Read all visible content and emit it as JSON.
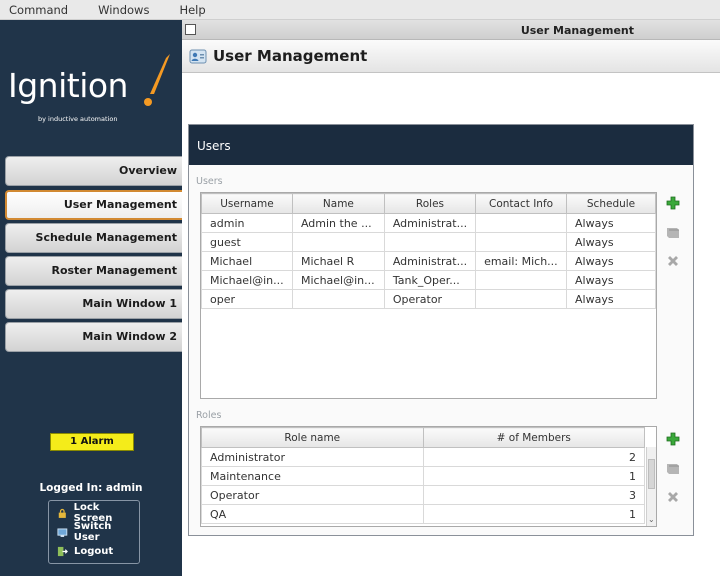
{
  "menu": [
    "Command",
    "Windows",
    "Help"
  ],
  "logo": {
    "word": "Ignition",
    "sub": "by inductive automation"
  },
  "nav": [
    {
      "label": "Overview"
    },
    {
      "label": "User Management"
    },
    {
      "label": "Schedule Management"
    },
    {
      "label": "Roster Management"
    },
    {
      "label": "Main Window 1"
    },
    {
      "label": "Main Window 2"
    }
  ],
  "alarm": {
    "label": "1 Alarm"
  },
  "logged_in": "Logged In: admin",
  "actions": [
    {
      "label": "Lock Screen",
      "icon": "lock-icon"
    },
    {
      "label": "Switch User",
      "icon": "monitor-icon"
    },
    {
      "label": "Logout",
      "icon": "logout-icon"
    }
  ],
  "window_title": "User Management",
  "header_title": "User Management",
  "panel": {
    "title": "Users",
    "users_label": "Users",
    "roles_label": "Roles"
  },
  "users_table": {
    "columns": [
      "Username",
      "Name",
      "Roles",
      "Contact Info",
      "Schedule"
    ],
    "rows": [
      [
        "admin",
        "Admin the ...",
        "Administrat...",
        "",
        "Always"
      ],
      [
        "guest",
        "",
        "",
        "",
        "Always"
      ],
      [
        "Michael",
        "Michael R",
        "Administrat...",
        "email: Mich...",
        "Always"
      ],
      [
        "Michael@in...",
        "Michael@in...",
        "Tank_Oper...",
        "",
        "Always"
      ],
      [
        "oper",
        "",
        "Operator",
        "",
        "Always"
      ]
    ]
  },
  "roles_table": {
    "columns": [
      "Role name",
      "# of Members"
    ],
    "rows": [
      [
        "Administrator",
        "2"
      ],
      [
        "Maintenance",
        "1"
      ],
      [
        "Operator",
        "3"
      ],
      [
        "QA",
        "1"
      ]
    ]
  },
  "colors": {
    "sidebar": "#203449",
    "panel_header": "#1b2c3f",
    "alarm": "#f4ec1a",
    "active_border": "#d28a33",
    "add": "#3aa83a"
  }
}
